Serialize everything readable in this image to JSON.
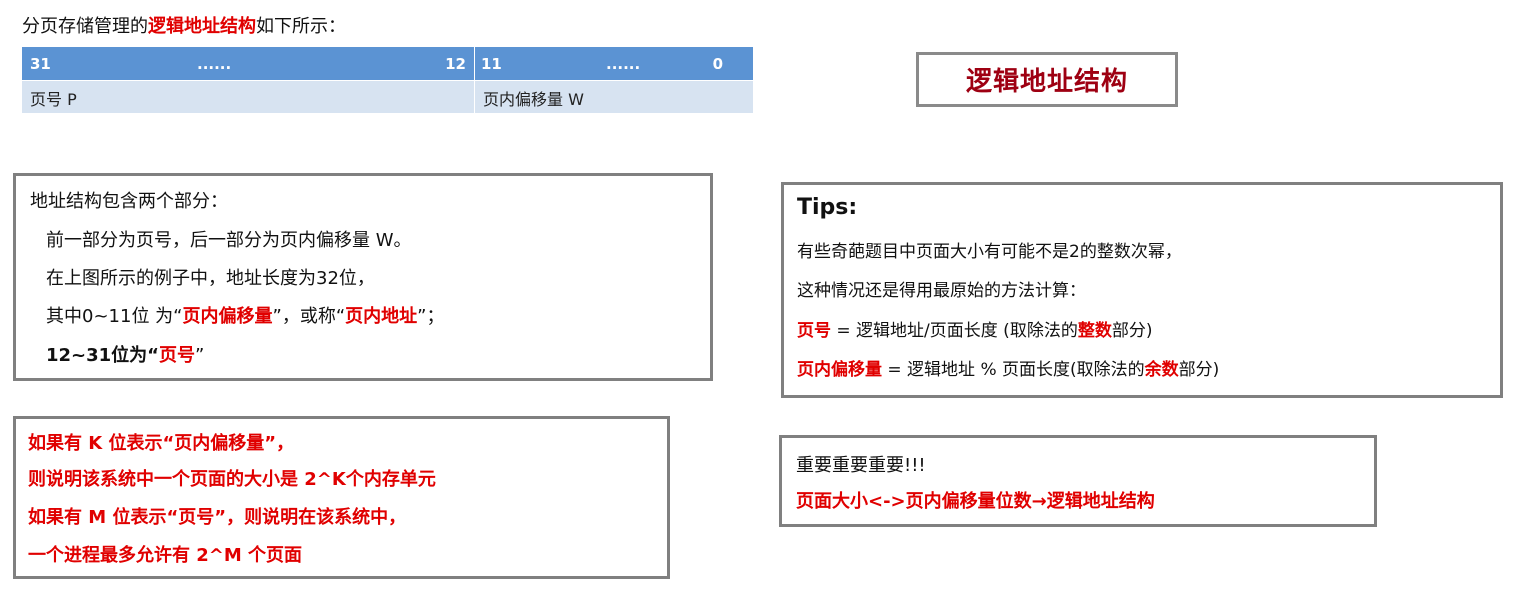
{
  "intro": {
    "prefix": "分页存储管理的",
    "highlight": "逻辑地址结构",
    "suffix": "如下所示："
  },
  "address_table": {
    "headers": {
      "high_start": "31",
      "high_dots": "......",
      "high_end": "12",
      "low_start": "11",
      "low_dots": "......",
      "low_end": "0"
    },
    "cells": {
      "page_number": "页号 P",
      "page_offset": "页内偏移量 W"
    }
  },
  "title_box": "逻辑地址结构",
  "structure_box": {
    "line1": "地址结构包含两个部分：",
    "line2": "前一部分为页号，后一部分为页内偏移量 W。",
    "line3": "在上图所示的例子中，地址长度为32位，",
    "line4_a": "其中0~11位 为“",
    "line4_b": "页内偏移量",
    "line4_c": "”，或称“",
    "line4_d": "页内地址",
    "line4_e": "”；",
    "line5_a": "12~31位为“",
    "line5_b": "页号",
    "line5_c": "”"
  },
  "tips_box": {
    "heading": "Tips:",
    "line1": "有些奇葩题目中页面大小有可能不是2的整数次幂，",
    "line2": "这种情况还是得用最原始的方法计算：",
    "line3_a": "页号",
    "line3_b": " = 逻辑地址/页面长度 (取除法的",
    "line3_c": "整数",
    "line3_d": "部分)",
    "line4_a": "页内偏移量",
    "line4_b": " = 逻辑地址 % 页面长度(取除法的",
    "line4_c": "余数",
    "line4_d": "部分)"
  },
  "kbits_box": {
    "line1": "如果有 K 位表示“页内偏移量”，",
    "line2": "则说明该系统中一个页面的大小是 2^K个内存单元",
    "line3": "如果有 M 位表示“页号”，则说明在该系统中，",
    "line4": "一个进程最多允许有 2^M 个页面"
  },
  "important_box": {
    "line1": "重要重要重要!!!",
    "line2": "页面大小<->页内偏移量位数→逻辑地址结构"
  }
}
